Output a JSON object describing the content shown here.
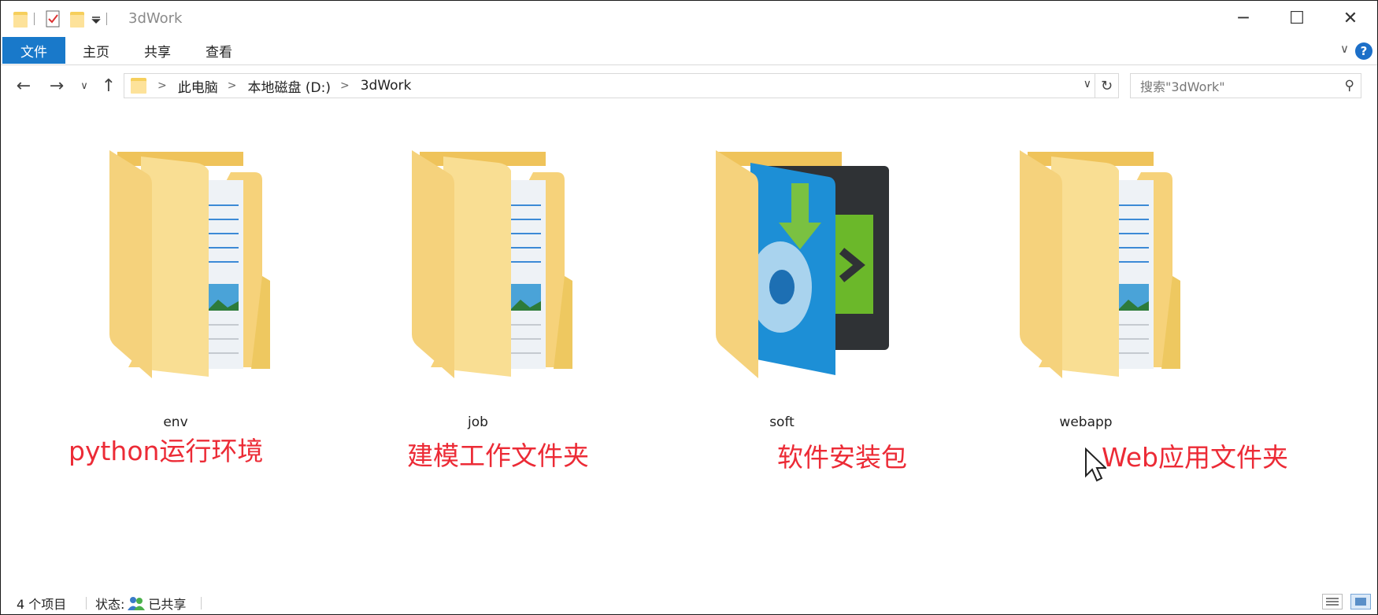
{
  "window": {
    "title": "3dWork",
    "minimize_glyph": "─",
    "maximize_glyph": "☐",
    "close_glyph": "✕"
  },
  "ribbon": {
    "tabs": [
      {
        "label": "文件"
      },
      {
        "label": "主页"
      },
      {
        "label": "共享"
      },
      {
        "label": "查看"
      }
    ],
    "collapse_glyph": "∨",
    "help_glyph": "?"
  },
  "nav": {
    "back_glyph": "←",
    "forward_glyph": "→",
    "recent_glyph": "∨",
    "up_glyph": "↑",
    "breadcrumb": [
      "此电脑",
      "本地磁盘 (D:)",
      "3dWork"
    ],
    "crumb_separator": ">",
    "dropdown_glyph": "∨",
    "refresh_glyph": "↻",
    "search_placeholder": "搜索\"3dWork\"",
    "search_glyph": "⚲"
  },
  "folders": [
    {
      "name": "env",
      "icon": "folder-documents-icon",
      "annotation": "python运行环境"
    },
    {
      "name": "job",
      "icon": "folder-documents-icon",
      "annotation": "建模工作文件夹"
    },
    {
      "name": "soft",
      "icon": "folder-installer-icon",
      "annotation": "软件安装包"
    },
    {
      "name": "webapp",
      "icon": "folder-documents-icon",
      "annotation": "Web应用文件夹"
    }
  ],
  "status": {
    "item_count": "4 个项目",
    "state_label": "状态:",
    "state_value": "已共享"
  },
  "colors": {
    "accent": "#1979ca",
    "annotation": "#ec2b36",
    "folder": "#f7d77b"
  }
}
